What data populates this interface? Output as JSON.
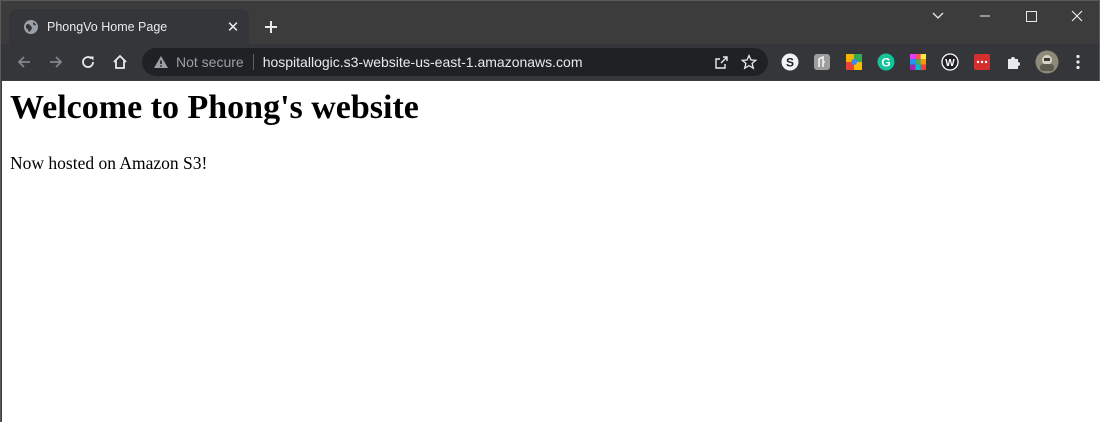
{
  "browser": {
    "tab": {
      "title": "PhongVo Home Page",
      "favicon_icon": "globe-icon",
      "close_label": "✕"
    },
    "new_tab_icon": "plus-icon",
    "window_controls": [
      "tab-search-icon",
      "minimize-icon",
      "maximize-icon",
      "close-icon"
    ],
    "toolbar": {
      "nav_icons": [
        "back-arrow-icon",
        "forward-arrow-icon",
        "reload-icon",
        "home-icon"
      ],
      "security_label": "Not secure",
      "url": "hospitallogic.s3-website-us-east-1.amazonaws.com",
      "omnibox_actions": [
        "share-icon",
        "bookmark-star-icon"
      ],
      "extensions": [
        {
          "name": "s-extension-icon",
          "color": "#ffffff"
        },
        {
          "name": "a-extension-icon",
          "color": "#9e9e9e"
        },
        {
          "name": "puzzle-colorful-extension-icon",
          "color": "#f4b400"
        },
        {
          "name": "grammarly-icon",
          "color": "#15c39a"
        },
        {
          "name": "palette-grid-extension-icon",
          "color": "#e040fb"
        },
        {
          "name": "w-extension-icon",
          "color": "#ffffff"
        },
        {
          "name": "red-dots-extension-icon",
          "color": "#d32f2f"
        }
      ],
      "extensions_menu_icon": "puzzle-icon",
      "profile_icon": "avatar",
      "menu_icon": "kebab-menu-icon"
    },
    "colors": {
      "frame": "#3c3c3c",
      "toolbar": "#35363a",
      "omnibox": "#202124",
      "text": "#e8eaed",
      "muted": "#9aa0a6"
    }
  },
  "page": {
    "heading": "Welcome to Phong's website",
    "paragraph": "Now hosted on Amazon S3!"
  }
}
